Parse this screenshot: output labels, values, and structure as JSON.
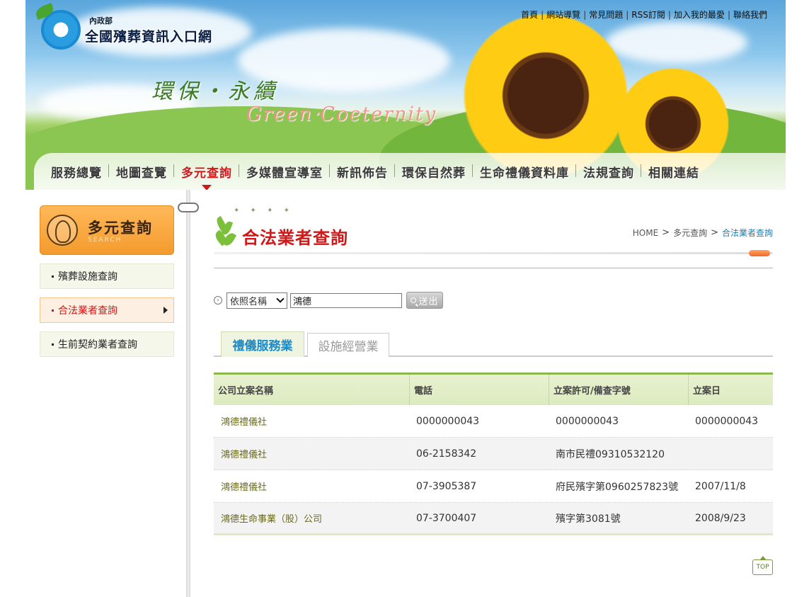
{
  "site": {
    "ministry": "內政部",
    "name": "全國殯葬資訊入口網",
    "slogan_cn": "環保‧永續",
    "slogan_en": "Green‧Coeternity"
  },
  "top_links": [
    "首頁",
    "網站導覽",
    "常見問題",
    "RSS訂閱",
    "加入我的最愛",
    "聯絡我們"
  ],
  "main_nav": {
    "items": [
      "服務總覽",
      "地圖查覽",
      "多元查詢",
      "多媒體宣導室",
      "新訊佈告",
      "環保自然葬",
      "生命禮儀資料庫",
      "法規查詢",
      "相關連結"
    ],
    "active": "多元查詢"
  },
  "sidebar": {
    "title": "多元查詢",
    "subtitle": "SEARCH",
    "items": [
      {
        "label": "殯葬設施查詢",
        "active": false
      },
      {
        "label": "合法業者查詢",
        "active": true
      },
      {
        "label": "生前契約業者查詢",
        "active": false
      }
    ]
  },
  "content": {
    "title": "合法業者查詢",
    "breadcrumb": {
      "home": "HOME",
      "parent": "多元查詢",
      "current": "合法業者查詢"
    },
    "search": {
      "select_value": "依照名稱",
      "input_value": "鴻德",
      "button_label": "送出"
    },
    "tabs": [
      {
        "label": "禮儀服務業",
        "active": true
      },
      {
        "label": "設施經營業",
        "active": false
      }
    ],
    "table": {
      "headers": [
        "公司立案名稱",
        "電話",
        "立案許可/備查字號",
        "立案日"
      ],
      "rows": [
        [
          "鴻德禮儀社",
          "0000000043",
          "0000000043",
          "0000000043"
        ],
        [
          "鴻德禮儀社",
          "06-2158342",
          "南市民禮09310532120",
          ""
        ],
        [
          "鴻德禮儀社",
          "07-3905387",
          "府民殯字第0960257823號",
          "2007/11/8"
        ],
        [
          "鴻德生命事業（股）公司",
          "07-3700407",
          "殯字第3081號",
          "2008/9/23"
        ]
      ]
    },
    "top_label": "TOP"
  }
}
